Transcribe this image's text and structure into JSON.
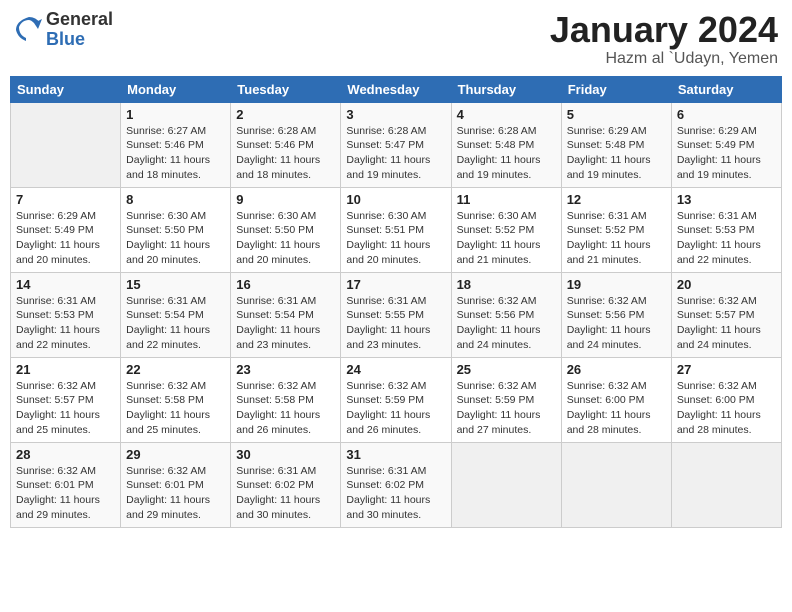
{
  "header": {
    "logo_general": "General",
    "logo_blue": "Blue",
    "month_title": "January 2024",
    "subtitle": "Hazm al `Udayn, Yemen"
  },
  "weekdays": [
    "Sunday",
    "Monday",
    "Tuesday",
    "Wednesday",
    "Thursday",
    "Friday",
    "Saturday"
  ],
  "weeks": [
    [
      {
        "day": "",
        "info": ""
      },
      {
        "day": "1",
        "info": "Sunrise: 6:27 AM\nSunset: 5:46 PM\nDaylight: 11 hours\nand 18 minutes."
      },
      {
        "day": "2",
        "info": "Sunrise: 6:28 AM\nSunset: 5:46 PM\nDaylight: 11 hours\nand 18 minutes."
      },
      {
        "day": "3",
        "info": "Sunrise: 6:28 AM\nSunset: 5:47 PM\nDaylight: 11 hours\nand 19 minutes."
      },
      {
        "day": "4",
        "info": "Sunrise: 6:28 AM\nSunset: 5:48 PM\nDaylight: 11 hours\nand 19 minutes."
      },
      {
        "day": "5",
        "info": "Sunrise: 6:29 AM\nSunset: 5:48 PM\nDaylight: 11 hours\nand 19 minutes."
      },
      {
        "day": "6",
        "info": "Sunrise: 6:29 AM\nSunset: 5:49 PM\nDaylight: 11 hours\nand 19 minutes."
      }
    ],
    [
      {
        "day": "7",
        "info": "Sunrise: 6:29 AM\nSunset: 5:49 PM\nDaylight: 11 hours\nand 20 minutes."
      },
      {
        "day": "8",
        "info": "Sunrise: 6:30 AM\nSunset: 5:50 PM\nDaylight: 11 hours\nand 20 minutes."
      },
      {
        "day": "9",
        "info": "Sunrise: 6:30 AM\nSunset: 5:50 PM\nDaylight: 11 hours\nand 20 minutes."
      },
      {
        "day": "10",
        "info": "Sunrise: 6:30 AM\nSunset: 5:51 PM\nDaylight: 11 hours\nand 20 minutes."
      },
      {
        "day": "11",
        "info": "Sunrise: 6:30 AM\nSunset: 5:52 PM\nDaylight: 11 hours\nand 21 minutes."
      },
      {
        "day": "12",
        "info": "Sunrise: 6:31 AM\nSunset: 5:52 PM\nDaylight: 11 hours\nand 21 minutes."
      },
      {
        "day": "13",
        "info": "Sunrise: 6:31 AM\nSunset: 5:53 PM\nDaylight: 11 hours\nand 22 minutes."
      }
    ],
    [
      {
        "day": "14",
        "info": "Sunrise: 6:31 AM\nSunset: 5:53 PM\nDaylight: 11 hours\nand 22 minutes."
      },
      {
        "day": "15",
        "info": "Sunrise: 6:31 AM\nSunset: 5:54 PM\nDaylight: 11 hours\nand 22 minutes."
      },
      {
        "day": "16",
        "info": "Sunrise: 6:31 AM\nSunset: 5:54 PM\nDaylight: 11 hours\nand 23 minutes."
      },
      {
        "day": "17",
        "info": "Sunrise: 6:31 AM\nSunset: 5:55 PM\nDaylight: 11 hours\nand 23 minutes."
      },
      {
        "day": "18",
        "info": "Sunrise: 6:32 AM\nSunset: 5:56 PM\nDaylight: 11 hours\nand 24 minutes."
      },
      {
        "day": "19",
        "info": "Sunrise: 6:32 AM\nSunset: 5:56 PM\nDaylight: 11 hours\nand 24 minutes."
      },
      {
        "day": "20",
        "info": "Sunrise: 6:32 AM\nSunset: 5:57 PM\nDaylight: 11 hours\nand 24 minutes."
      }
    ],
    [
      {
        "day": "21",
        "info": "Sunrise: 6:32 AM\nSunset: 5:57 PM\nDaylight: 11 hours\nand 25 minutes."
      },
      {
        "day": "22",
        "info": "Sunrise: 6:32 AM\nSunset: 5:58 PM\nDaylight: 11 hours\nand 25 minutes."
      },
      {
        "day": "23",
        "info": "Sunrise: 6:32 AM\nSunset: 5:58 PM\nDaylight: 11 hours\nand 26 minutes."
      },
      {
        "day": "24",
        "info": "Sunrise: 6:32 AM\nSunset: 5:59 PM\nDaylight: 11 hours\nand 26 minutes."
      },
      {
        "day": "25",
        "info": "Sunrise: 6:32 AM\nSunset: 5:59 PM\nDaylight: 11 hours\nand 27 minutes."
      },
      {
        "day": "26",
        "info": "Sunrise: 6:32 AM\nSunset: 6:00 PM\nDaylight: 11 hours\nand 28 minutes."
      },
      {
        "day": "27",
        "info": "Sunrise: 6:32 AM\nSunset: 6:00 PM\nDaylight: 11 hours\nand 28 minutes."
      }
    ],
    [
      {
        "day": "28",
        "info": "Sunrise: 6:32 AM\nSunset: 6:01 PM\nDaylight: 11 hours\nand 29 minutes."
      },
      {
        "day": "29",
        "info": "Sunrise: 6:32 AM\nSunset: 6:01 PM\nDaylight: 11 hours\nand 29 minutes."
      },
      {
        "day": "30",
        "info": "Sunrise: 6:31 AM\nSunset: 6:02 PM\nDaylight: 11 hours\nand 30 minutes."
      },
      {
        "day": "31",
        "info": "Sunrise: 6:31 AM\nSunset: 6:02 PM\nDaylight: 11 hours\nand 30 minutes."
      },
      {
        "day": "",
        "info": ""
      },
      {
        "day": "",
        "info": ""
      },
      {
        "day": "",
        "info": ""
      }
    ]
  ]
}
